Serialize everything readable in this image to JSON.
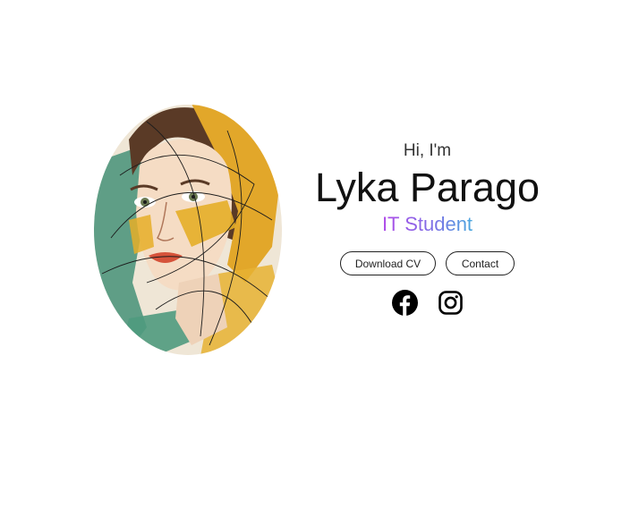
{
  "hero": {
    "greeting": "Hi, I'm",
    "name": "Lyka Parago",
    "role": "IT Student",
    "portrait_alt": "illustrated portrait of a woman"
  },
  "buttons": {
    "download_cv": "Download CV",
    "contact": "Contact"
  },
  "socials": [
    {
      "icon": "facebook-icon"
    },
    {
      "icon": "instagram-icon"
    }
  ],
  "colors": {
    "role_gradient": [
      "#b04be8",
      "#7f6fe6",
      "#4aa7de"
    ],
    "text": "#111111",
    "button_border": "#222222"
  }
}
